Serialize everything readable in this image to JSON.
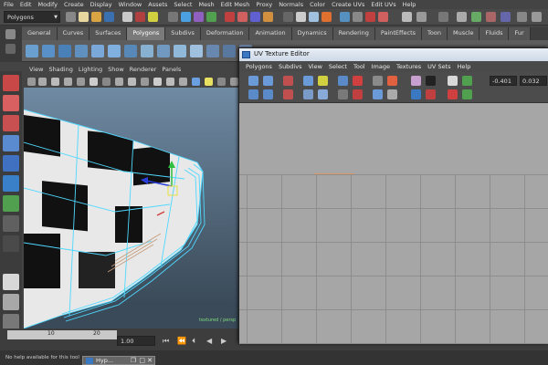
{
  "menubar": [
    "File",
    "Edit",
    "Modify",
    "Create",
    "Display",
    "Window",
    "Assets",
    "Select",
    "Mesh",
    "Edit Mesh",
    "Proxy",
    "Normals",
    "Color",
    "Create UVs",
    "Edit UVs",
    "Help"
  ],
  "statusline": {
    "mode": "Polygons"
  },
  "shelf": {
    "tabs": [
      "General",
      "Curves",
      "Surfaces",
      "Polygons",
      "Subdivs",
      "Deformation",
      "Animation",
      "Dynamics",
      "Rendering",
      "PaintEffects",
      "Toon",
      "Muscle",
      "Fluids",
      "Fur"
    ],
    "active_tab": "Polygons"
  },
  "viewport": {
    "menu": [
      "View",
      "Shading",
      "Lighting",
      "Show",
      "Renderer",
      "Panels"
    ],
    "label": "textured / persp"
  },
  "timeline": {
    "ticks": [
      "10",
      "20"
    ],
    "current_frame": "1.00"
  },
  "helpline": {
    "text": "No help available for this tool",
    "hypershade_tab": "Hyp..."
  },
  "uv_editor": {
    "title": "UV Texture Editor",
    "menu": [
      "Polygons",
      "Subdivs",
      "View",
      "Select",
      "Tool",
      "Image",
      "Textures",
      "UV Sets",
      "Help"
    ],
    "u_value": "-0.401",
    "v_value": "0.032"
  },
  "colors": {
    "accent": "#7a7a7a",
    "uv_background": "#a6a6a6",
    "wire": "#4fd8ff"
  }
}
